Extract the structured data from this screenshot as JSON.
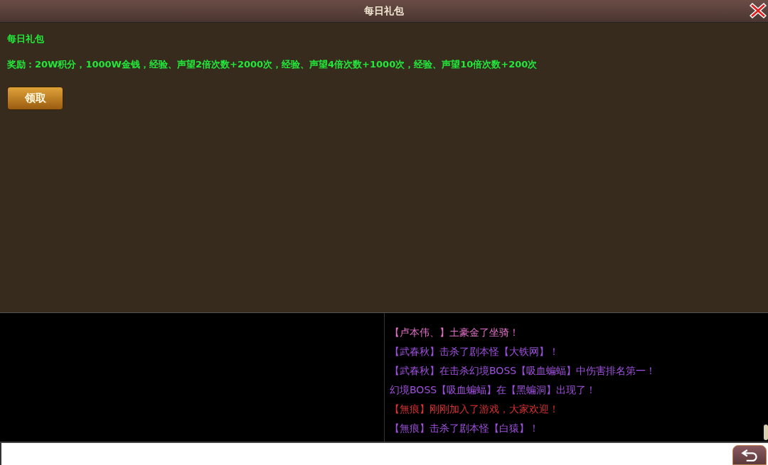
{
  "dialog": {
    "title": "每日礼包",
    "heading": "每日礼包",
    "reward": "奖励：20W积分，1000W金钱，经验、声望2倍次数+2000次，经验、声望4倍次数+1000次，经验、声望10倍次数+200次",
    "claim_button": "领取"
  },
  "chat": {
    "messages": [
      {
        "text": "【卢本伟、】土豪金了坐骑！",
        "color": "#e070c8"
      },
      {
        "text": "【武春秋】击杀了剧本怪【大铁网】！",
        "color": "#a050e0"
      },
      {
        "text": "【武春秋】在击杀幻境BOSS【吸血蝙蝠】中伤害排名第一！",
        "color": "#a050e0"
      },
      {
        "text": "幻境BOSS【吸血蝙蝠】在【黑蝙洞】出现了！",
        "color": "#a050e0"
      },
      {
        "text": "【無痕】刚刚加入了游戏，大家欢迎！",
        "color": "#e03030"
      },
      {
        "text": "【無痕】击杀了剧本怪【白猿】！",
        "color": "#a050e0"
      }
    ]
  }
}
